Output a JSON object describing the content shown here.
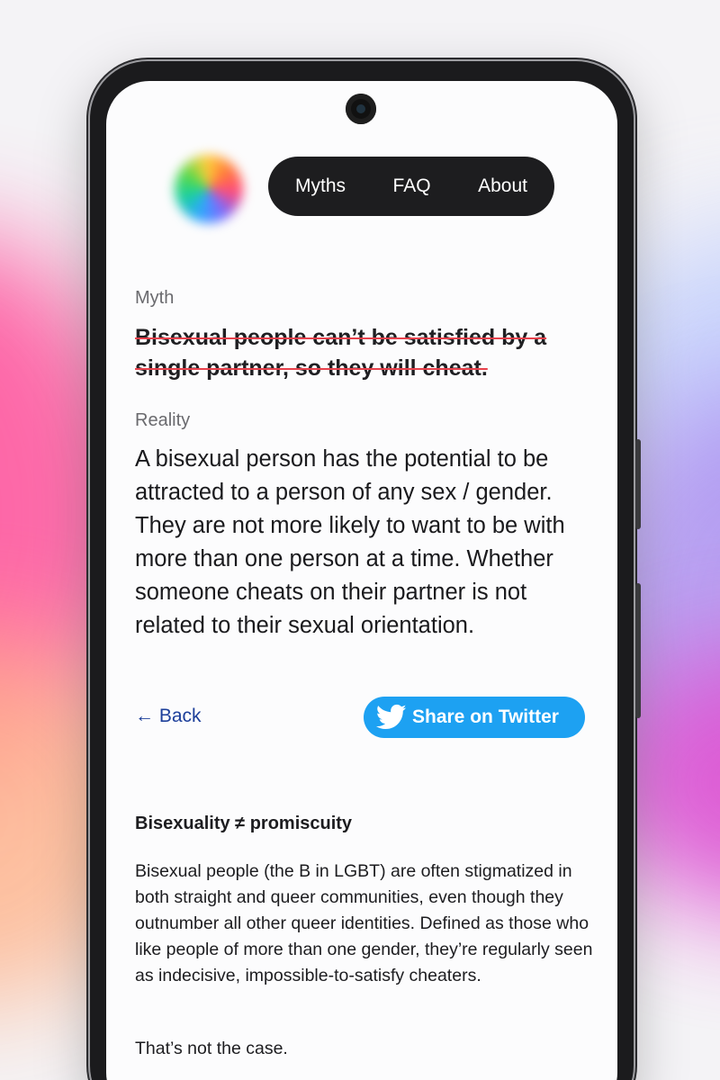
{
  "nav": {
    "items": [
      {
        "label": "Myths"
      },
      {
        "label": "FAQ"
      },
      {
        "label": "About"
      }
    ]
  },
  "myth": {
    "label": "Myth",
    "text": "Bisexual people can’t be satisfied by a single partner, so they will cheat."
  },
  "reality": {
    "label": "Reality",
    "text": "A bisexual person has the potential to be attracted to a person of any sex / gender. They are not more likely to want to be with more than one person at a time. Whether someone cheats on their partner is not related to their sexual orientation."
  },
  "actions": {
    "back_label": "← Back",
    "share_label": "Share on Twitter",
    "share_icon": "twitter-bird-icon"
  },
  "article": {
    "title": "Bisexuality ≠ promiscuity",
    "body": "Bisexual people (the B in LGBT) are often stigmatized in both straight and queer communities, even though they outnumber all other queer identities. Defined as those who like people of more than one gender, they’re regularly seen as indecisive, impossible-to-satisfy cheaters.",
    "closing": "That’s not the case."
  },
  "colors": {
    "strike": "#e8414c",
    "twitter": "#1da1f2",
    "link": "#1d3f9a",
    "nav_bg": "#1d1d1f"
  }
}
